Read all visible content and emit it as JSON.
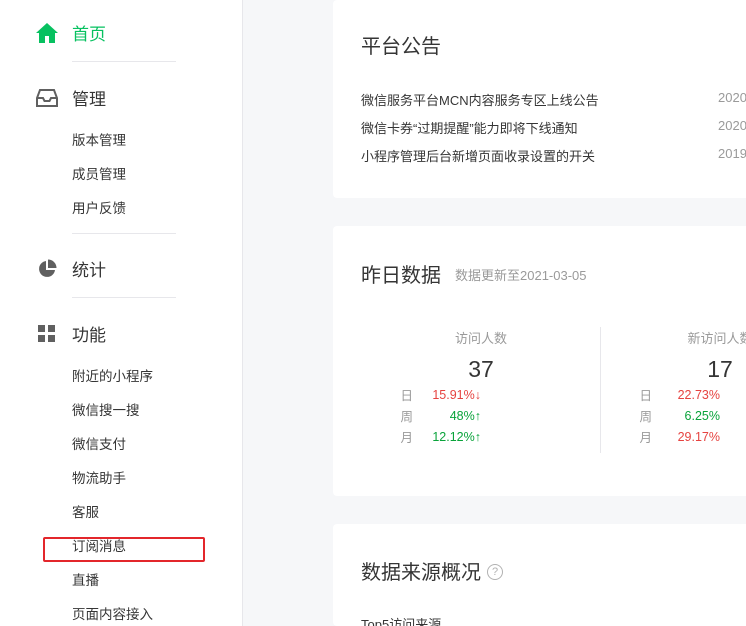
{
  "sidebar": {
    "home_label": "首页",
    "manage_label": "管理",
    "manage_items": [
      "版本管理",
      "成员管理",
      "用户反馈"
    ],
    "stats_label": "统计",
    "features_label": "功能",
    "feature_items": [
      "附近的小程序",
      "微信搜一搜",
      "微信支付",
      "物流助手",
      "客服",
      "订阅消息",
      "直播",
      "页面内容接入"
    ],
    "highlighted_item": "订阅消息",
    "accent_color": "#07c160",
    "highlight_color": "#e3262b"
  },
  "announcements": {
    "title": "平台公告",
    "items": [
      {
        "text": "微信服务平台MCN内容服务专区上线公告",
        "date": "2020"
      },
      {
        "text": "微信卡券“过期提醒”能力即将下线通知",
        "date": "2020"
      },
      {
        "text": "小程序管理后台新增页面收录设置的开关",
        "date": "2019"
      }
    ]
  },
  "yesterday": {
    "title": "昨日数据",
    "update_note": "数据更新至2021-03-05",
    "stats": [
      {
        "label": "访问人数",
        "value": "37",
        "rows": [
          {
            "k": "日",
            "v": "15.91%↓",
            "dir": "down"
          },
          {
            "k": "周",
            "v": "48%↑",
            "dir": "up"
          },
          {
            "k": "月",
            "v": "12.12%↑",
            "dir": "up"
          }
        ]
      },
      {
        "label": "新访问人数",
        "value": "17",
        "rows": [
          {
            "k": "日",
            "v": "22.73%",
            "dir": "down"
          },
          {
            "k": "周",
            "v": "6.25%",
            "dir": "up"
          },
          {
            "k": "月",
            "v": "29.17%",
            "dir": "down"
          }
        ]
      }
    ]
  },
  "sources": {
    "title": "数据来源概况",
    "help_glyph": "?",
    "subtitle": "Top5访问来源"
  }
}
